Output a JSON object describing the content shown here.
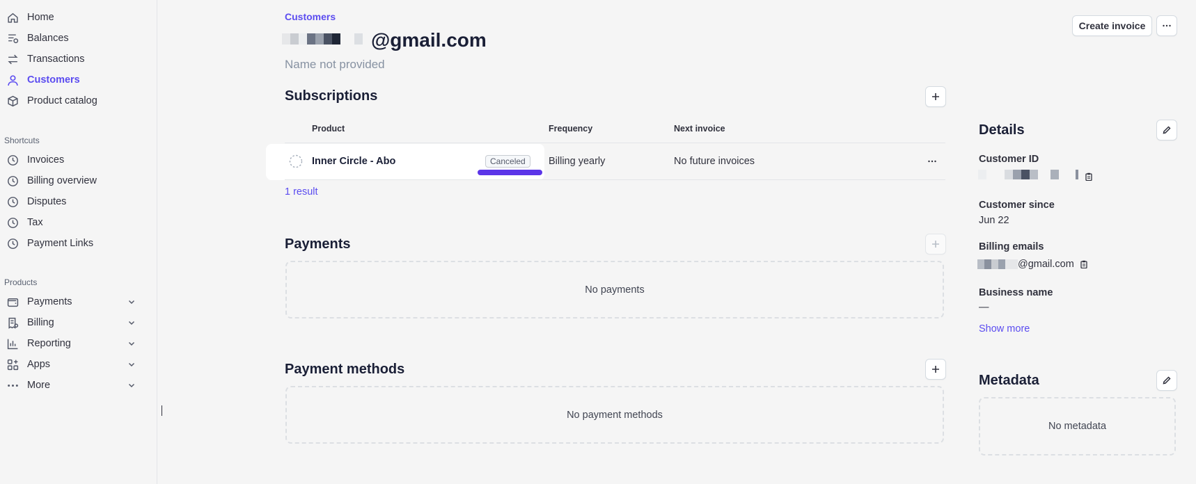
{
  "sidebar": {
    "items": [
      {
        "label": "Home",
        "icon": "home-icon"
      },
      {
        "label": "Balances",
        "icon": "balances-icon"
      },
      {
        "label": "Transactions",
        "icon": "transactions-icon"
      },
      {
        "label": "Customers",
        "icon": "customers-icon",
        "active": true
      },
      {
        "label": "Product catalog",
        "icon": "product-catalog-icon"
      }
    ],
    "shortcuts_label": "Shortcuts",
    "shortcuts": [
      {
        "label": "Invoices",
        "icon": "clock-icon"
      },
      {
        "label": "Billing overview",
        "icon": "clock-icon"
      },
      {
        "label": "Disputes",
        "icon": "clock-icon"
      },
      {
        "label": "Tax",
        "icon": "clock-icon"
      },
      {
        "label": "Payment Links",
        "icon": "clock-icon"
      }
    ],
    "products_label": "Products",
    "products": [
      {
        "label": "Payments",
        "icon": "wallet-icon"
      },
      {
        "label": "Billing",
        "icon": "billing-icon"
      },
      {
        "label": "Reporting",
        "icon": "reporting-icon"
      },
      {
        "label": "Apps",
        "icon": "apps-icon"
      },
      {
        "label": "More",
        "icon": "more-dots-icon"
      }
    ]
  },
  "header": {
    "breadcrumb": "Customers",
    "email_suffix": "@gmail.com",
    "name": "Name not provided",
    "create_invoice_label": "Create invoice"
  },
  "subscriptions": {
    "title": "Subscriptions",
    "columns": [
      "Product",
      "Frequency",
      "Next invoice"
    ],
    "rows": [
      {
        "product": "Inner Circle - Abo",
        "status": "Canceled",
        "frequency": "Billing yearly",
        "next_invoice": "No future invoices"
      }
    ],
    "result_count": "1 result"
  },
  "payments": {
    "title": "Payments",
    "empty": "No payments"
  },
  "payment_methods": {
    "title": "Payment methods",
    "empty": "No payment methods"
  },
  "details": {
    "title": "Details",
    "customer_id_label": "Customer ID",
    "customer_since_label": "Customer since",
    "customer_since": "Jun 22",
    "billing_emails_label": "Billing emails",
    "billing_email_suffix": "@gmail.com",
    "business_name_label": "Business name",
    "business_name": "—",
    "show_more": "Show more"
  },
  "metadata": {
    "title": "Metadata",
    "empty": "No metadata"
  },
  "colors": {
    "accent": "#5b4cf0",
    "background": "#f5f5f5",
    "text": "#1a1f36"
  }
}
